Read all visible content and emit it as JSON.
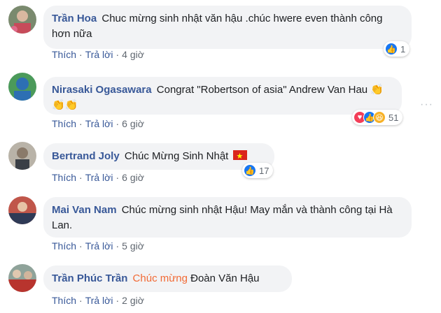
{
  "comments": [
    {
      "author": "Trần Hoa",
      "text": "Chuc mừng sinh nhật văn hậu .chúc hwere even thành công hơn nữa",
      "like": "Thích",
      "reply": "Trả lời",
      "time": "4 giờ",
      "reaction_count": "1"
    },
    {
      "author": "Nirasaki Ogasawara",
      "text": "Congrat \"Robertson of asia\" Andrew Van Hau",
      "emoji": [
        "clapping-hands",
        "clapping-hands",
        "clapping-hands"
      ],
      "like": "Thích",
      "reply": "Trả lời",
      "time": "6 giờ",
      "reaction_count": "51"
    },
    {
      "author": "Bertrand Joly",
      "text": "Chúc Mừng Sinh Nhật",
      "emoji": [
        "vietnam-flag"
      ],
      "like": "Thích",
      "reply": "Trả lời",
      "time": "6 giờ",
      "reaction_count": "17"
    },
    {
      "author": "Mai Van Nam",
      "text": "Chúc mừng sinh nhật Hậu! May mắn và thành công tại Hà Lan.",
      "like": "Thích",
      "reply": "Trả lời",
      "time": "5 giờ"
    },
    {
      "author": "Trần Phúc Trần",
      "mention": "Chúc mừng",
      "text": "Đoàn Văn Hậu",
      "like": "Thích",
      "reply": "Trả lời",
      "time": "2 giờ"
    }
  ],
  "colors": {
    "author": "#385898",
    "mention": "#f26a35",
    "bubble": "#f2f3f5",
    "meta": "#606770",
    "like_reaction": "#1877f2",
    "love_reaction": "#f33e58",
    "haha_reaction": "#f7b125"
  },
  "icons": {
    "more_options": "more-options-icon",
    "like": "like-reaction-icon",
    "love": "love-reaction-icon",
    "haha": "haha-reaction-icon"
  }
}
